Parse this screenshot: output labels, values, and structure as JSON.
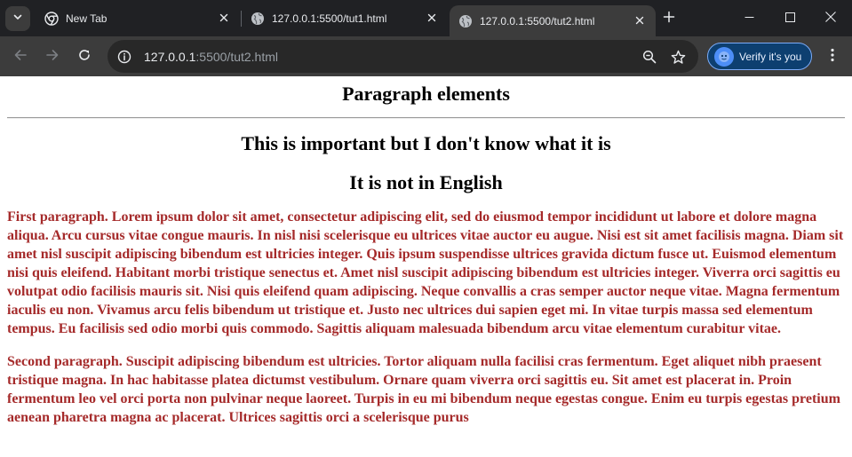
{
  "browser": {
    "tabs": [
      {
        "title": "New Tab",
        "favicon": "chrome-icon",
        "active": false
      },
      {
        "title": "127.0.0.1:5500/tut1.html",
        "favicon": "globe-icon",
        "active": false
      },
      {
        "title": "127.0.0.1:5500/tut2.html",
        "favicon": "globe-icon",
        "active": true
      }
    ],
    "address_bar": {
      "host": "127.0.0.1",
      "path": ":5500/tut2.html"
    },
    "verify_button_label": "Verify it's you"
  },
  "page": {
    "heading": "Paragraph elements",
    "subheadings": [
      "This is important but I don't know what it is",
      "It is not in English"
    ],
    "paragraphs": [
      "First paragraph. Lorem ipsum dolor sit amet, consectetur adipiscing elit, sed do eiusmod tempor incididunt ut labore et dolore magna aliqua. Arcu cursus vitae congue mauris. In nisl nisi scelerisque eu ultrices vitae auctor eu augue. Nisi est sit amet facilisis magna. Diam sit amet nisl suscipit adipiscing bibendum est ultricies integer. Quis ipsum suspendisse ultrices gravida dictum fusce ut. Euismod elementum nisi quis eleifend. Habitant morbi tristique senectus et. Amet nisl suscipit adipiscing bibendum est ultricies integer. Viverra orci sagittis eu volutpat odio facilisis mauris sit. Nisi quis eleifend quam adipiscing. Neque convallis a cras semper auctor neque vitae. Magna fermentum iaculis eu non. Vivamus arcu felis bibendum ut tristique et. Justo nec ultrices dui sapien eget mi. In vitae turpis massa sed elementum tempus. Eu facilisis sed odio morbi quis commodo. Sagittis aliquam malesuada bibendum arcu vitae elementum curabitur vitae.",
      "Second paragraph. Suscipit adipiscing bibendum est ultricies. Tortor aliquam nulla facilisi cras fermentum. Eget aliquet nibh praesent tristique magna. In hac habitasse platea dictumst vestibulum. Ornare quam viverra orci sagittis eu. Sit amet est placerat in. Proin fermentum leo vel orci porta non pulvinar neque laoreet. Turpis in eu mi bibendum neque egestas congue. Enim eu turpis egestas pretium aenean pharetra magna ac placerat. Ultrices sagittis orci a scelerisque purus"
    ],
    "paragraph_color": "#a52a2a"
  },
  "theme": {
    "tabstrip_bg": "#202124",
    "toolbar_bg": "#3c3c3c",
    "omnibox_bg": "#282828",
    "verify_bg": "#0d3f70"
  }
}
